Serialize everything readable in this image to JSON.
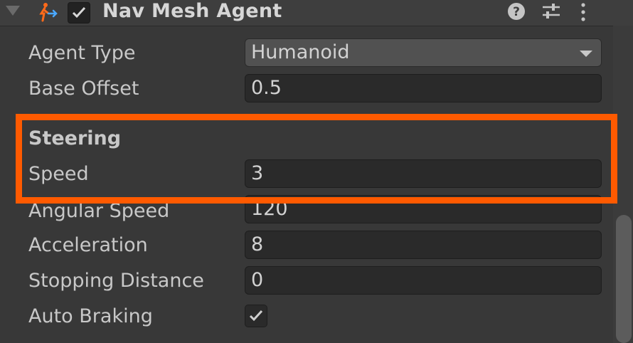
{
  "component": {
    "title": "Nav Mesh Agent",
    "enabled": true,
    "icons": [
      "foldout-triangle-icon",
      "nav-mesh-agent-icon",
      "help-icon",
      "presets-icon",
      "context-menu-icon"
    ]
  },
  "fields": {
    "agent_type": {
      "label": "Agent Type",
      "value": "Humanoid"
    },
    "base_offset": {
      "label": "Base Offset",
      "value": "0.5"
    },
    "steering_header": "Steering",
    "speed": {
      "label": "Speed",
      "value": "3"
    },
    "angular_speed": {
      "label": "Angular Speed",
      "value": "120"
    },
    "acceleration": {
      "label": "Acceleration",
      "value": "8"
    },
    "stopping_distance": {
      "label": "Stopping Distance",
      "value": "0"
    },
    "auto_braking": {
      "label": "Auto Braking",
      "checked": true
    }
  },
  "colors": {
    "highlight": "#ff5a00",
    "background": "#383838",
    "field": "#2a2a2a"
  }
}
